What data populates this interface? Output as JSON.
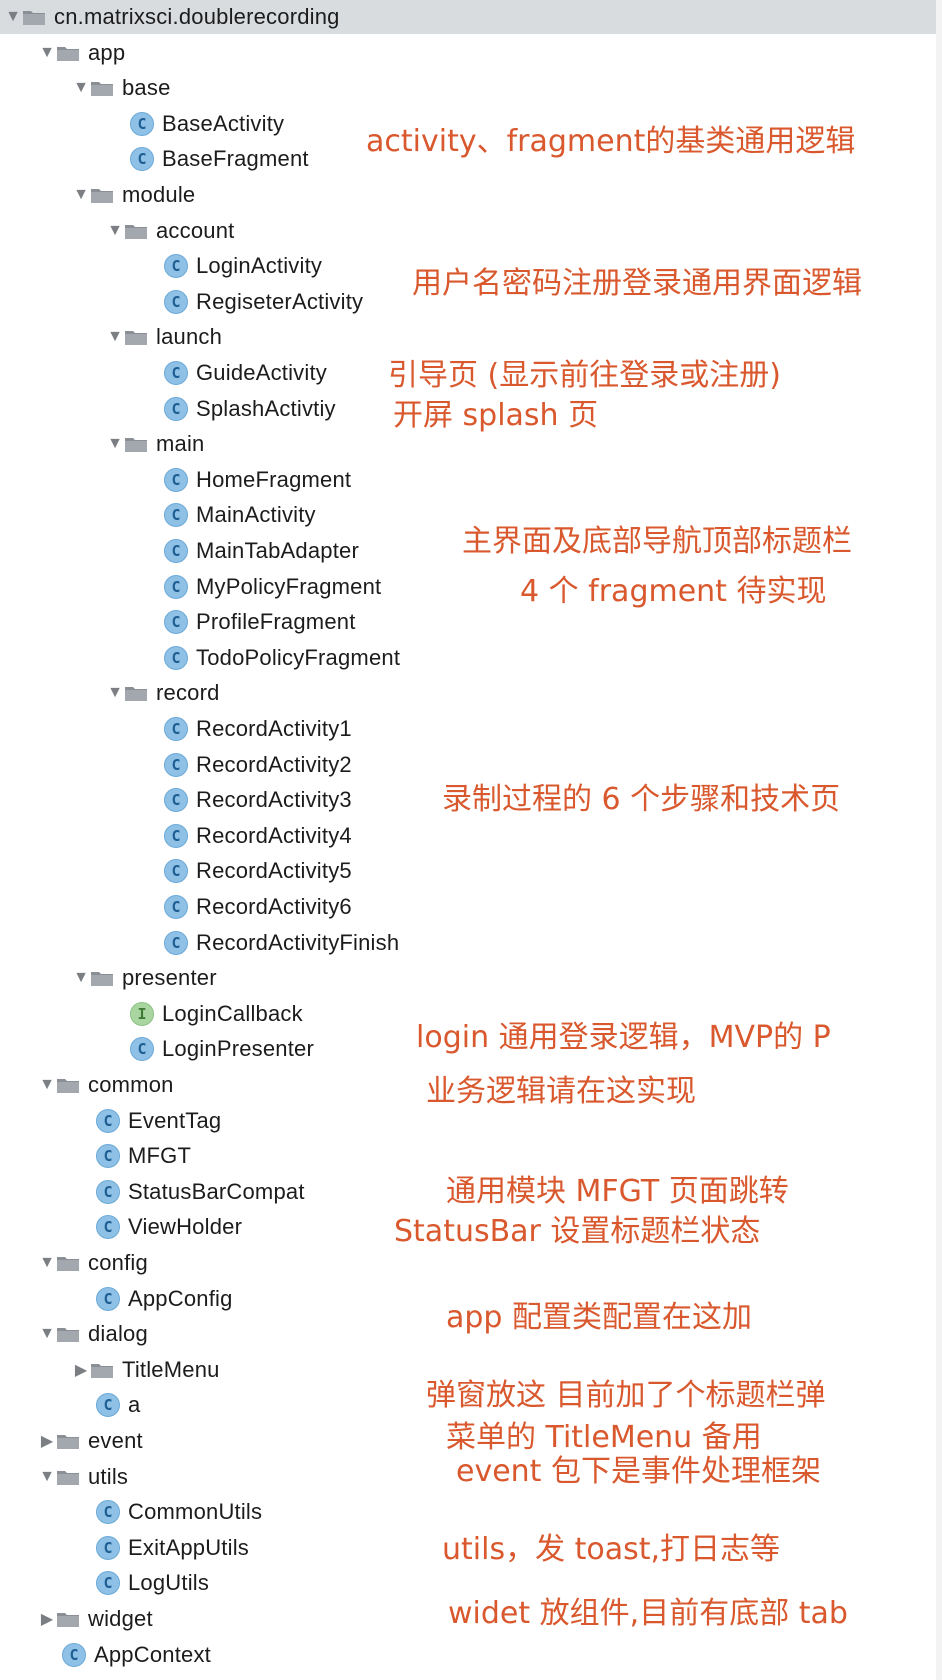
{
  "tree": [
    {
      "label": "cn.matrixsci.doublerecording",
      "kind": "folder",
      "depth": 0,
      "arrow": "down",
      "selected": true
    },
    {
      "label": "app",
      "kind": "folder",
      "depth": 1,
      "arrow": "down"
    },
    {
      "label": "base",
      "kind": "folder",
      "depth": 2,
      "arrow": "down"
    },
    {
      "label": "BaseActivity",
      "kind": "class",
      "depth": 3,
      "arrow": ""
    },
    {
      "label": "BaseFragment",
      "kind": "class",
      "depth": 3,
      "arrow": ""
    },
    {
      "label": "module",
      "kind": "folder",
      "depth": 2,
      "arrow": "down"
    },
    {
      "label": "account",
      "kind": "folder",
      "depth": 3,
      "arrow": "down"
    },
    {
      "label": "LoginActivity",
      "kind": "class",
      "depth": 4,
      "arrow": ""
    },
    {
      "label": "RegiseterActivity",
      "kind": "class",
      "depth": 4,
      "arrow": ""
    },
    {
      "label": "launch",
      "kind": "folder",
      "depth": 3,
      "arrow": "down"
    },
    {
      "label": "GuideActivity",
      "kind": "class",
      "depth": 4,
      "arrow": ""
    },
    {
      "label": "SplashActivtiy",
      "kind": "class",
      "depth": 4,
      "arrow": ""
    },
    {
      "label": "main",
      "kind": "folder",
      "depth": 3,
      "arrow": "down"
    },
    {
      "label": "HomeFragment",
      "kind": "class",
      "depth": 4,
      "arrow": ""
    },
    {
      "label": "MainActivity",
      "kind": "class",
      "depth": 4,
      "arrow": ""
    },
    {
      "label": "MainTabAdapter",
      "kind": "class",
      "depth": 4,
      "arrow": ""
    },
    {
      "label": "MyPolicyFragment",
      "kind": "class",
      "depth": 4,
      "arrow": ""
    },
    {
      "label": "ProfileFragment",
      "kind": "class",
      "depth": 4,
      "arrow": ""
    },
    {
      "label": "TodoPolicyFragment",
      "kind": "class",
      "depth": 4,
      "arrow": ""
    },
    {
      "label": "record",
      "kind": "folder",
      "depth": 3,
      "arrow": "down"
    },
    {
      "label": "RecordActivity1",
      "kind": "class",
      "depth": 4,
      "arrow": ""
    },
    {
      "label": "RecordActivity2",
      "kind": "class",
      "depth": 4,
      "arrow": ""
    },
    {
      "label": "RecordActivity3",
      "kind": "class",
      "depth": 4,
      "arrow": ""
    },
    {
      "label": "RecordActivity4",
      "kind": "class",
      "depth": 4,
      "arrow": ""
    },
    {
      "label": "RecordActivity5",
      "kind": "class",
      "depth": 4,
      "arrow": ""
    },
    {
      "label": "RecordActivity6",
      "kind": "class",
      "depth": 4,
      "arrow": ""
    },
    {
      "label": "RecordActivityFinish",
      "kind": "class",
      "depth": 4,
      "arrow": ""
    },
    {
      "label": "presenter",
      "kind": "folder",
      "depth": 2,
      "arrow": "down"
    },
    {
      "label": "LoginCallback",
      "kind": "interface",
      "depth": 3,
      "arrow": ""
    },
    {
      "label": "LoginPresenter",
      "kind": "class",
      "depth": 3,
      "arrow": ""
    },
    {
      "label": "common",
      "kind": "folder",
      "depth": 1,
      "arrow": "down"
    },
    {
      "label": "EventTag",
      "kind": "class",
      "depth": 2,
      "arrow": ""
    },
    {
      "label": "MFGT",
      "kind": "class",
      "depth": 2,
      "arrow": ""
    },
    {
      "label": "StatusBarCompat",
      "kind": "class",
      "depth": 2,
      "arrow": ""
    },
    {
      "label": "ViewHolder",
      "kind": "class",
      "depth": 2,
      "arrow": ""
    },
    {
      "label": "config",
      "kind": "folder",
      "depth": 1,
      "arrow": "down"
    },
    {
      "label": "AppConfig",
      "kind": "class",
      "depth": 2,
      "arrow": ""
    },
    {
      "label": "dialog",
      "kind": "folder",
      "depth": 1,
      "arrow": "down"
    },
    {
      "label": "TitleMenu",
      "kind": "folder",
      "depth": 2,
      "arrow": "right"
    },
    {
      "label": "a",
      "kind": "class",
      "depth": 2,
      "arrow": ""
    },
    {
      "label": "event",
      "kind": "folder",
      "depth": 1,
      "arrow": "right"
    },
    {
      "label": "utils",
      "kind": "folder",
      "depth": 1,
      "arrow": "down"
    },
    {
      "label": "CommonUtils",
      "kind": "class",
      "depth": 2,
      "arrow": ""
    },
    {
      "label": "ExitAppUtils",
      "kind": "class",
      "depth": 2,
      "arrow": ""
    },
    {
      "label": "LogUtils",
      "kind": "class",
      "depth": 2,
      "arrow": ""
    },
    {
      "label": "widget",
      "kind": "folder",
      "depth": 1,
      "arrow": "right"
    },
    {
      "label": "AppContext",
      "kind": "class",
      "depth": 1,
      "arrow": ""
    }
  ],
  "annotations": [
    "activity、fragment的基类通用逻辑",
    "用户名密码注册登录通用界面逻辑",
    "引导页 (显示前往登录或注册)",
    "开屏 splash 页",
    "主界面及底部导航顶部标题栏",
    "4 个 fragment 待实现",
    "录制过程的 6 个步骤和技术页",
    "login 通用登录逻辑，MVP的 P",
    "业务逻辑请在这实现",
    "通用模块 MFGT 页面跳转",
    "StatusBar 设置标题栏状态",
    "app 配置类配置在这加",
    "弹窗放这 目前加了个标题栏弹",
    "菜单的 TitleMenu 备用",
    "event 包下是事件处理框架",
    "utils，发 toast,打日志等",
    "widet 放组件,目前有底部 tab"
  ],
  "colors": {
    "annotation": "#d9582d",
    "folder": "#8a8f96",
    "class_icon": "#8fc1e6",
    "interface_icon": "#a9d6a0",
    "selected_row": "#d9dcdf"
  },
  "icons": {
    "folder": "folder-icon",
    "class": "class-icon",
    "interface": "interface-icon",
    "expanded": "chevron-down-icon",
    "collapsed": "chevron-right-icon"
  }
}
